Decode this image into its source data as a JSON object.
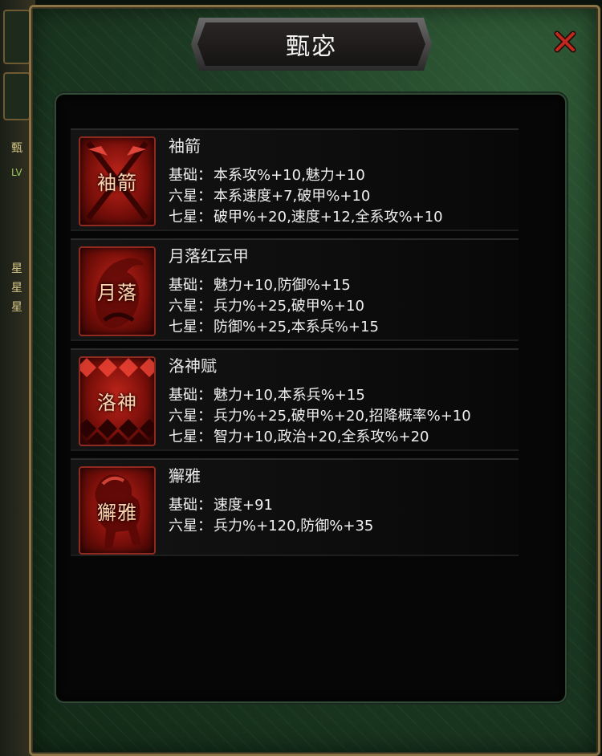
{
  "dialog": {
    "title": "甄宓"
  },
  "background": {
    "stub_text_1": "甄",
    "stub_text_2": "LV",
    "stub_text_3": "星",
    "stub_text_4": "星",
    "stub_text_5": "星"
  },
  "items": [
    {
      "name": "袖箭",
      "icon_text": "袖箭",
      "icon": "crossed-swords-icon",
      "stats": [
        {
          "label": "基础：",
          "value": "本系攻%+10,魅力+10"
        },
        {
          "label": "六星：",
          "value": "本系速度+7,破甲%+10"
        },
        {
          "label": "七星：",
          "value": "破甲%+20,速度+12,全系攻%+10"
        }
      ]
    },
    {
      "name": "月落红云甲",
      "icon_text": "月落",
      "icon": "helmet-plume-icon",
      "stats": [
        {
          "label": "基础：",
          "value": "魅力+10,防御%+15"
        },
        {
          "label": "六星：",
          "value": "兵力%+25,破甲%+10"
        },
        {
          "label": "七星：",
          "value": "防御%+25,本系兵%+15"
        }
      ]
    },
    {
      "name": "洛神赋",
      "icon_text": "洛神",
      "icon": "diamond-pattern-icon",
      "stats": [
        {
          "label": "基础：",
          "value": "魅力+10,本系兵%+15"
        },
        {
          "label": "六星：",
          "value": "兵力%+25,破甲%+20,招降概率%+10"
        },
        {
          "label": "七星：",
          "value": "智力+10,政治+20,全系攻%+20"
        }
      ]
    },
    {
      "name": "獬雅",
      "icon_text": "獬雅",
      "icon": "horse-icon",
      "stats": [
        {
          "label": "基础：",
          "value": "速度+91"
        },
        {
          "label": "六星：",
          "value": "兵力%+120,防御%+35"
        }
      ]
    }
  ],
  "colors": {
    "frame_gold": "#8a7445",
    "icon_red": "#c2261b",
    "close_red": "#c0281e"
  }
}
